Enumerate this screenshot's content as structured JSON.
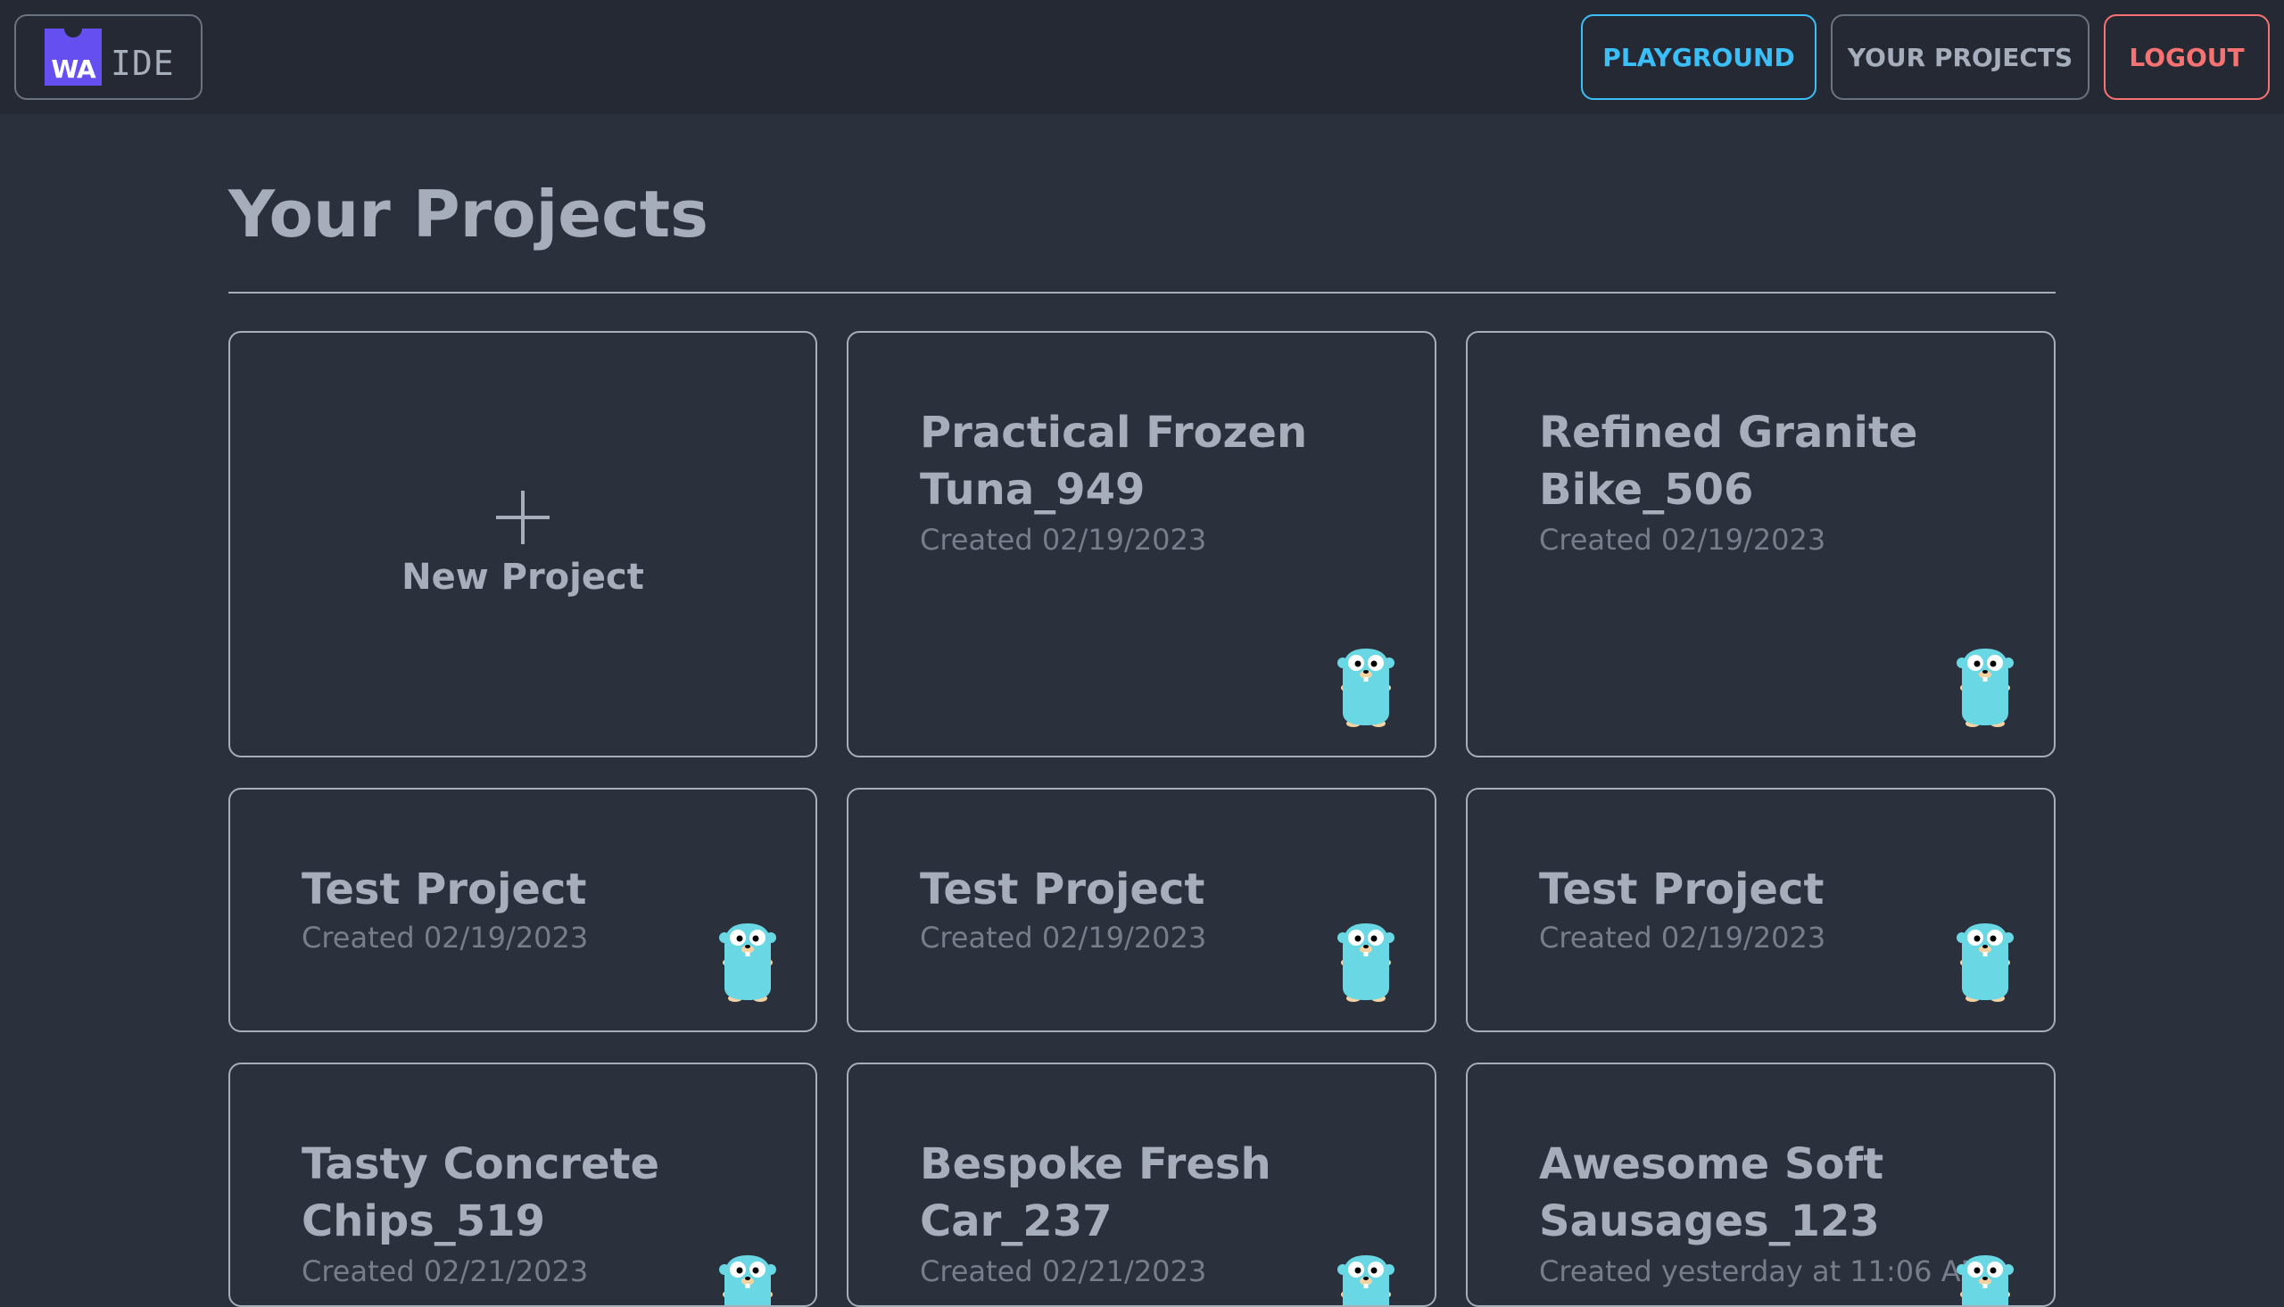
{
  "navbar": {
    "logo_mark": "WA",
    "logo_text": "IDE",
    "playground_label": "PLAYGROUND",
    "projects_label": "YOUR PROJECTS",
    "logout_label": "LOGOUT"
  },
  "page": {
    "title": "Your Projects"
  },
  "new_project": {
    "label": "New Project",
    "icon": "plus-icon"
  },
  "projects": [
    {
      "name": "Practical Frozen Tuna_949",
      "created": "Created 02/19/2023",
      "icon": "gopher-icon"
    },
    {
      "name": "Refined Granite Bike_506",
      "created": "Created 02/19/2023",
      "icon": "gopher-icon"
    },
    {
      "name": "Test Project",
      "created": "Created 02/19/2023",
      "icon": "gopher-icon"
    },
    {
      "name": "Test Project",
      "created": "Created 02/19/2023",
      "icon": "gopher-icon"
    },
    {
      "name": "Test Project",
      "created": "Created 02/19/2023",
      "icon": "gopher-icon"
    },
    {
      "name": "Tasty Concrete Chips_519",
      "created": "Created 02/21/2023",
      "icon": "gopher-icon"
    },
    {
      "name": "Bespoke Fresh Car_237",
      "created": "Created 02/21/2023",
      "icon": "gopher-icon"
    },
    {
      "name": "Awesome Soft Sausages_123",
      "created": "Created yesterday at 11:06 AM",
      "icon": "gopher-icon"
    }
  ],
  "colors": {
    "background": "#2a303c",
    "navbar": "#242933",
    "logo_accent": "#654ff0",
    "playground": "#3abff8",
    "logout": "#f87272",
    "gopher": "#6ad7e5"
  }
}
